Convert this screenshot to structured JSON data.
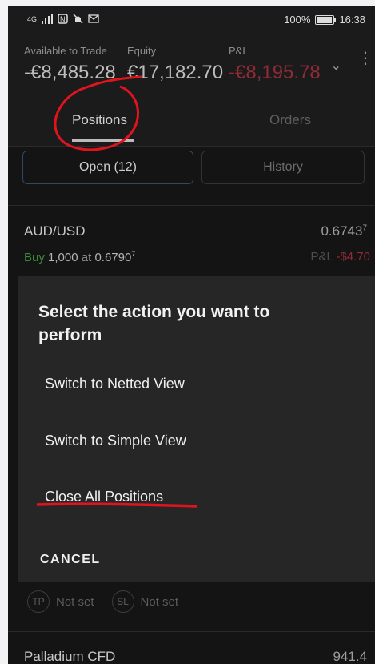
{
  "status_bar": {
    "left_icons": [
      "signal-icon",
      "nfc-icon",
      "mute-icon",
      "mail-icon"
    ],
    "network_label": "4G",
    "battery": "100%",
    "battery_level": 1.0,
    "time": "16:38"
  },
  "header": {
    "available_label": "Available to Trade",
    "available_value": "-€8,485.28",
    "equity_label": "Equity",
    "equity_value": "€17,182.70",
    "pnl_label": "P&L",
    "pnl_value": "-€8,195.78"
  },
  "tabs": {
    "positions": "Positions",
    "orders": "Orders"
  },
  "segments": {
    "open": "Open (12)",
    "history": "History"
  },
  "positions": [
    {
      "symbol": "AUD/USD",
      "price_main": "0.6743",
      "price_sup": "7",
      "side": "Buy",
      "quantity": "1,000",
      "at": "at",
      "rate_main": "0.6790",
      "rate_sup": "7",
      "pl_label": "P&L",
      "pl_value": "-$4.70"
    }
  ],
  "tp_sl": {
    "tp": "TP",
    "tp_value": "Not set",
    "sl": "SL",
    "sl_value": "Not set"
  },
  "last_row": {
    "symbol": "Palladium CFD",
    "price": "941.4"
  },
  "dialog": {
    "title": "Select the action you want to perform",
    "options": [
      "Switch to Netted View",
      "Switch to Simple View",
      "Close All Positions"
    ],
    "cancel": "CANCEL"
  },
  "colors": {
    "annotation": "#e0141e",
    "pnl_negative": "#8e2b36",
    "buy": "#3c8a3c"
  }
}
